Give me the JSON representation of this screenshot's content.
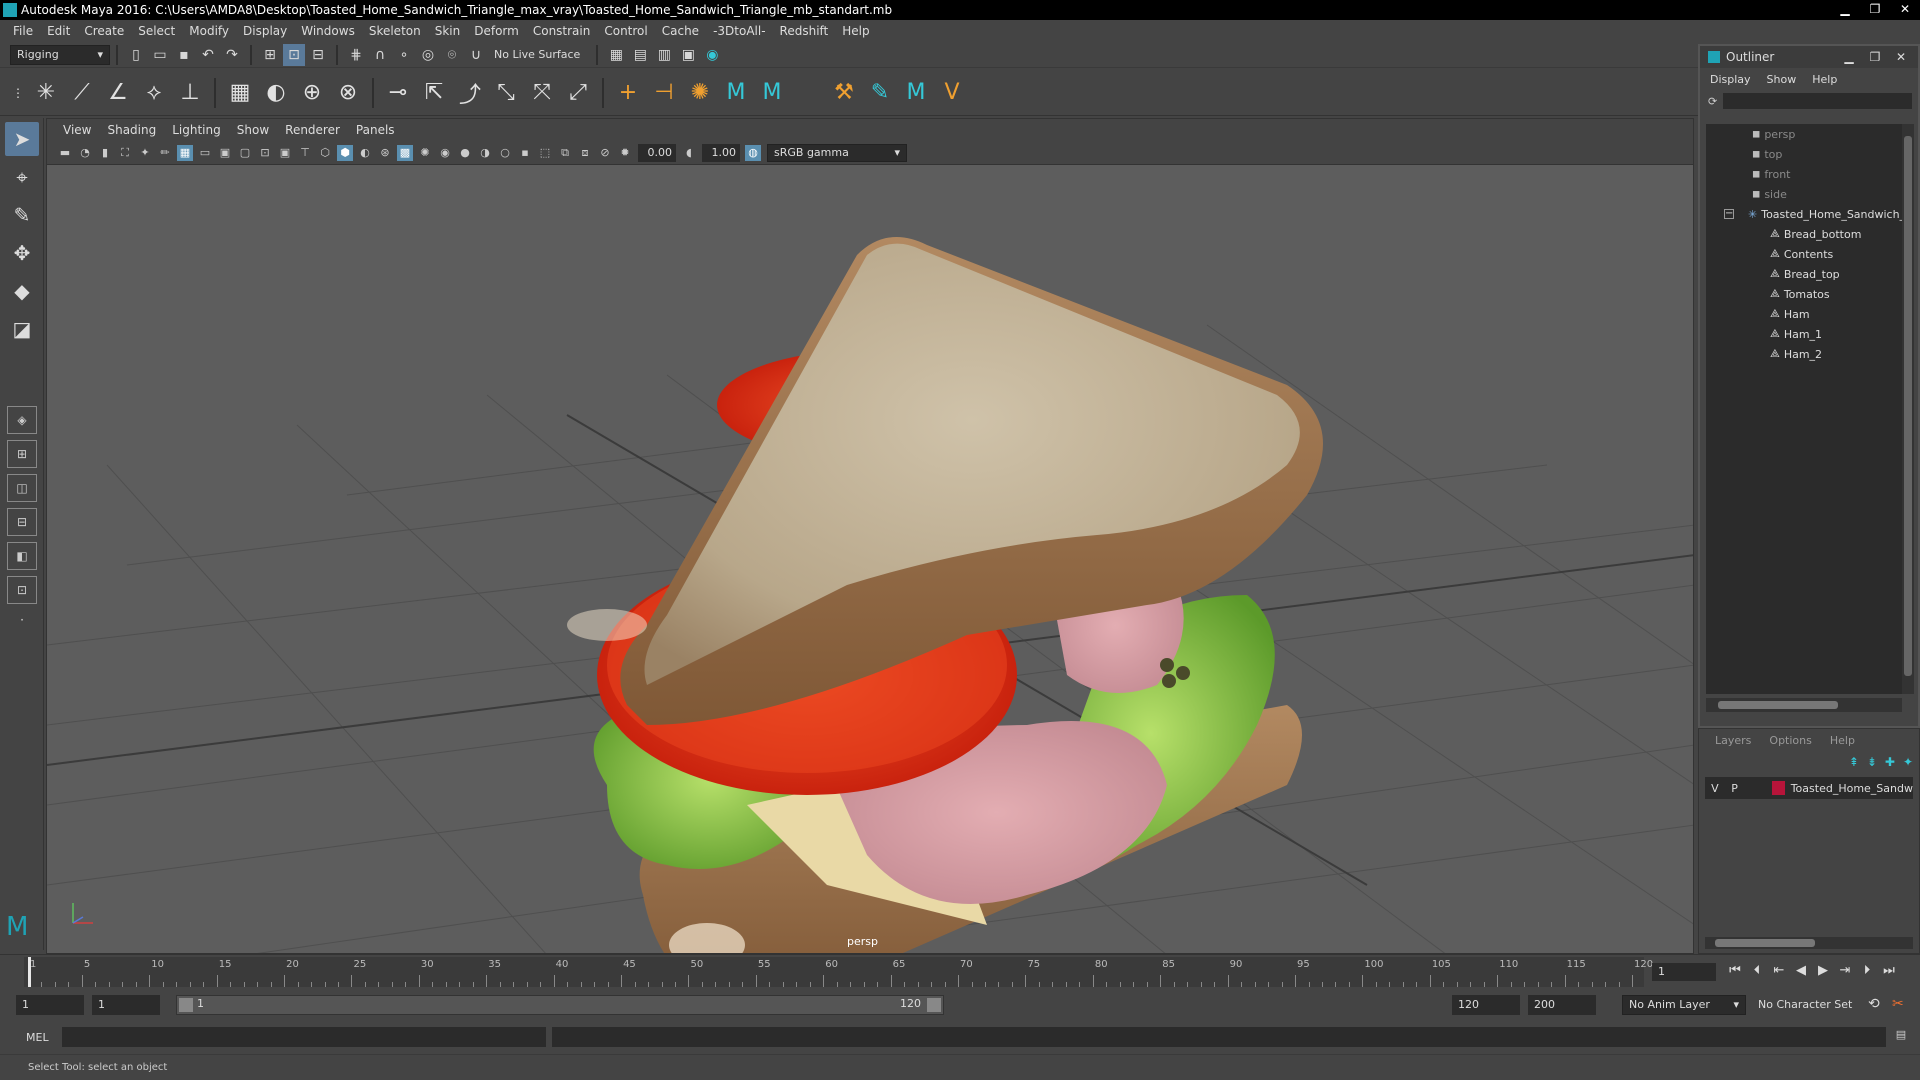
{
  "window": {
    "title": "Autodesk Maya 2016: C:\\Users\\AMDA8\\Desktop\\Toasted_Home_Sandwich_Triangle_max_vray\\Toasted_Home_Sandwich_Triangle_mb_standart.mb",
    "minimize": "▁",
    "maximize": "❐",
    "close": "✕"
  },
  "menubar": [
    "File",
    "Edit",
    "Create",
    "Select",
    "Modify",
    "Display",
    "Windows",
    "Skeleton",
    "Skin",
    "Deform",
    "Constrain",
    "Control",
    "Cache",
    "-3DtoAll-",
    "Redshift",
    "Help"
  ],
  "statusline": {
    "menuset": "Rigging",
    "live_surface": "No Live Surface"
  },
  "viewport": {
    "menus": [
      "View",
      "Shading",
      "Lighting",
      "Show",
      "Renderer",
      "Panels"
    ],
    "exposure": "0.00",
    "gamma": "1.00",
    "colorspace": "sRGB gamma",
    "camera": "persp"
  },
  "outliner": {
    "title": "Outliner",
    "menus": [
      "Display",
      "Show",
      "Help"
    ],
    "cameras": [
      "persp",
      "top",
      "front",
      "side"
    ],
    "root": "Toasted_Home_Sandwich_",
    "children": [
      "Bread_bottom",
      "Contents",
      "Bread_top",
      "Tomatos",
      "Ham",
      "Ham_1",
      "Ham_2"
    ]
  },
  "layers": {
    "menus": [
      "Layers",
      "Options",
      "Help"
    ],
    "row": {
      "v": "V",
      "p": "P",
      "name": "Toasted_Home_Sandw",
      "color": "#b7143a"
    }
  },
  "timeline": {
    "labels": [
      "1",
      "5",
      "10",
      "15",
      "20",
      "25",
      "30",
      "35",
      "40",
      "45",
      "50",
      "55",
      "60",
      "65",
      "70",
      "75",
      "80",
      "85",
      "90",
      "95",
      "100",
      "105",
      "110",
      "115",
      "120"
    ],
    "current_frame": "1"
  },
  "range": {
    "start": "1",
    "playback_start": "1",
    "slider_start": "1",
    "slider_end": "120",
    "playback_end": "120",
    "end": "200",
    "anim_layer": "No Anim Layer",
    "character_set": "No Character Set"
  },
  "cmdline": {
    "label": "MEL"
  },
  "helpline": {
    "text": "Select Tool: select an object"
  }
}
